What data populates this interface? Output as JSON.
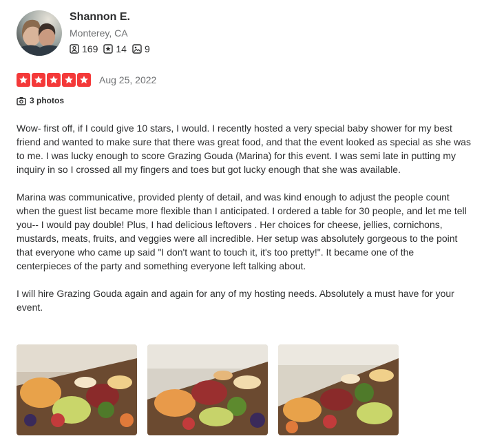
{
  "user": {
    "name": "Shannon E.",
    "location": "Monterey, CA",
    "stats": [
      {
        "icon": "friends-icon",
        "value": "169"
      },
      {
        "icon": "reviews-star-icon",
        "value": "14"
      },
      {
        "icon": "photos-icon",
        "value": "9"
      }
    ]
  },
  "review": {
    "rating": 5,
    "rating_max": 5,
    "date": "Aug 25, 2022",
    "photo_count_label": "3 photos",
    "paragraphs": [
      "Wow- first off, if I could give 10 stars, I would. I recently hosted a very special baby shower for my best friend and wanted to make sure that there was great food, and that the event looked as special as she was to me. I was lucky enough to score Grazing Gouda (Marina) for this event. I was semi late in putting my inquiry in so I crossed all my fingers and toes but got lucky enough that she was available.",
      "Marina was communicative, provided plenty of detail, and was kind enough to adjust the people count when the guest list became more flexible than I anticipated. I ordered a table for 30 people, and let me tell you-- I would pay double! Plus, I had delicious leftovers . Her choices for cheese, jellies, cornichons, mustards, meats, fruits, and veggies were all incredible. Her setup was absolutely gorgeous to the point that everyone who came up said \"I don't want to touch it, it's too pretty!\". It became one of the centerpieces of the party and something everyone left talking about.",
      "I will hire Grazing Gouda again and again for any of my hosting needs. Absolutely a must have for your event."
    ]
  },
  "colors": {
    "star_red": "#f43939",
    "text_primary": "#2d2e2f",
    "text_secondary": "#6e7072"
  }
}
